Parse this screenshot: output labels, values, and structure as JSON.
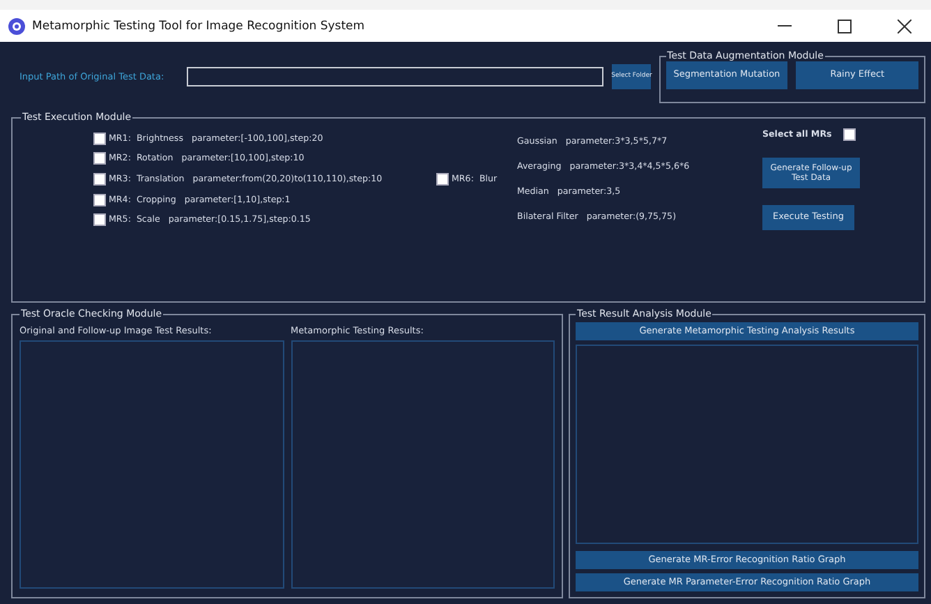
{
  "window": {
    "title": "Metamorphic Testing Tool for Image Recognition System"
  },
  "input_path": {
    "label": "Input Path of Original Test Data:",
    "button": "Select Folder"
  },
  "augmentation": {
    "title": "Test Data Augmentation Module",
    "buttons": [
      "Segmentation Mutation",
      "Rainy Effect"
    ]
  },
  "execution": {
    "title": "Test Execution Module",
    "mrs": [
      {
        "label": "MR1:  Brightness   parameter:[-100,100],step:20",
        "checked": false
      },
      {
        "label": "MR2:  Rotation   parameter:[10,100],step:10",
        "checked": false
      },
      {
        "label": "MR3:  Translation   parameter:from(20,20)to(110,110),step:10",
        "checked": false
      },
      {
        "label": "MR4:  Cropping   parameter:[1,10],step:1",
        "checked": false
      },
      {
        "label": "MR5:  Scale   parameter:[0.15,1.75],step:0.15",
        "checked": false
      }
    ],
    "blur": {
      "label": "MR6:  Blur",
      "checked": false,
      "options": [
        "Gaussian   parameter:3*3,5*5,7*7",
        "Averaging   parameter:3*3,4*4,5*5,6*6",
        "Median   parameter:3,5",
        "Bilateral Filter   parameter:(9,75,75)"
      ]
    },
    "select_all": {
      "label": "Select all MRs",
      "checked": false
    },
    "buttons": [
      "Generate Follow-up Test Data",
      "Execute Testing"
    ]
  },
  "oracle": {
    "title": "Test Oracle Checking Module",
    "panels": [
      "Original and Follow-up Image Test Results:",
      "Metamorphic Testing Results:"
    ]
  },
  "analysis": {
    "title": "Test Result Analysis Module",
    "top_button": "Generate Metamorphic Testing Analysis Results",
    "bottom_buttons": [
      "Generate MR-Error Recognition Ratio Graph",
      "Generate MR Parameter-Error Recognition Ratio Graph"
    ]
  }
}
